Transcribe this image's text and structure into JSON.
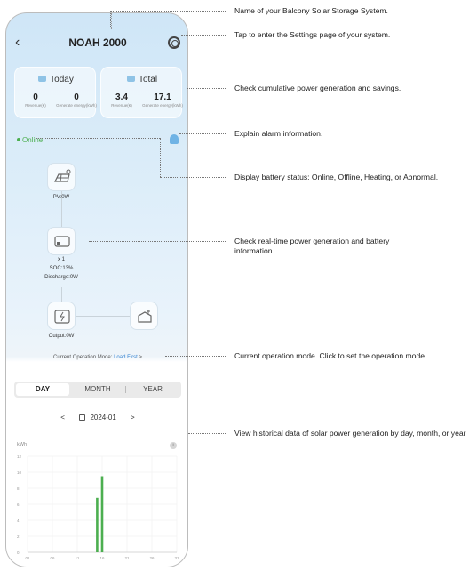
{
  "app": {
    "title": "NOAH 2000"
  },
  "today": {
    "title": "Today",
    "revenue": "0",
    "revenue_label": "Revenue(€)",
    "energy": "0",
    "energy_label": "Generate energy(kWh)"
  },
  "total": {
    "title": "Total",
    "revenue": "3.4",
    "revenue_label": "Revenue(€)",
    "energy": "17.1",
    "energy_label": "Generate energy(kWh)"
  },
  "status": {
    "online": "Online"
  },
  "flow": {
    "pv_label": "PV:0W",
    "battery_count": "x 1",
    "soc_label": "SOC:13%",
    "discharge_label": "Discharge:0W",
    "output_label": "Output:0W"
  },
  "mode": {
    "prefix": "Current Operation Mode: ",
    "value": "Load First",
    "chevron": ">"
  },
  "tabs": [
    {
      "label": "DAY"
    },
    {
      "label": "MONTH"
    },
    {
      "label": "YEAR"
    }
  ],
  "date": {
    "prev": "<",
    "value": "2024-01",
    "next": ">"
  },
  "chart_data": {
    "type": "bar",
    "ylabel": "kWh",
    "ylim": [
      0,
      12
    ],
    "yticks": [
      0,
      2,
      4,
      6,
      8,
      10,
      12
    ],
    "xticks": [
      "01",
      "06",
      "11",
      "16",
      "21",
      "26",
      "31"
    ],
    "x": [
      15,
      16
    ],
    "values": [
      6.8,
      9.5
    ],
    "grid": true,
    "color": "#4caf50"
  },
  "annotations": {
    "name": "Name of your Balcony Solar Storage System.",
    "settings": "Tap to enter the Settings page of your system.",
    "cumulative": "Check cumulative power generation and savings.",
    "alarm": "Explain alarm information.",
    "battery_status": "Display battery status: Online, Offline, Heating, or Abnormal.",
    "realtime": "Check real-time power generation and battery information.",
    "mode": "Current operation mode. Click to set the operation mode",
    "history": "View historical data of solar power generation by day, month, or year"
  }
}
